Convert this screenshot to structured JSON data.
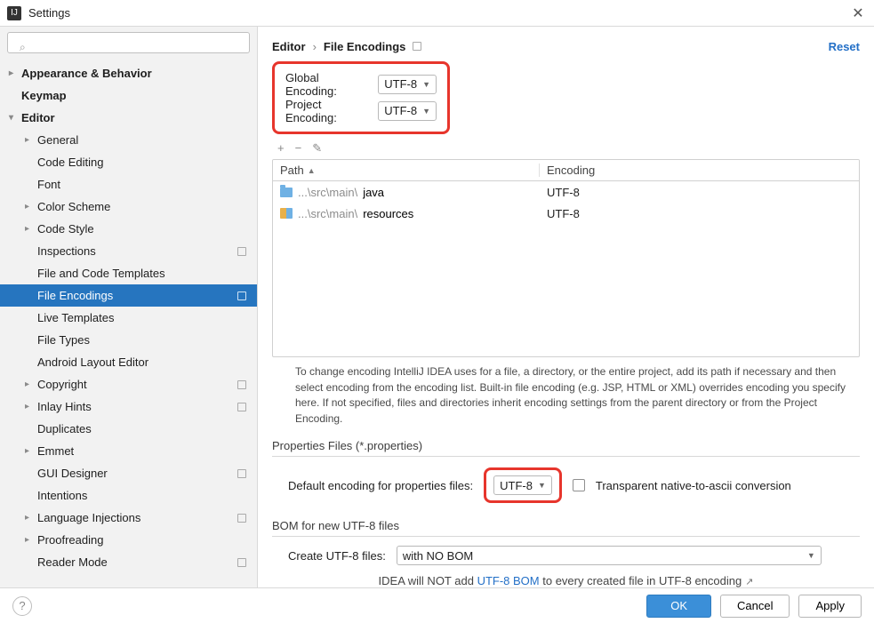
{
  "window": {
    "title": "Settings"
  },
  "search": {
    "placeholder": ""
  },
  "reset_label": "Reset",
  "breadcrumb": {
    "a": "Editor",
    "b": "File Encodings"
  },
  "sidebar": {
    "items": [
      {
        "label": "Appearance & Behavior",
        "depth": 0,
        "arrow": "right",
        "bold": true
      },
      {
        "label": "Keymap",
        "depth": 0,
        "arrow": "",
        "bold": true
      },
      {
        "label": "Editor",
        "depth": 0,
        "arrow": "down",
        "bold": true
      },
      {
        "label": "General",
        "depth": 1,
        "arrow": "right"
      },
      {
        "label": "Code Editing",
        "depth": 1,
        "arrow": ""
      },
      {
        "label": "Font",
        "depth": 1,
        "arrow": ""
      },
      {
        "label": "Color Scheme",
        "depth": 1,
        "arrow": "right"
      },
      {
        "label": "Code Style",
        "depth": 1,
        "arrow": "right"
      },
      {
        "label": "Inspections",
        "depth": 1,
        "arrow": "",
        "badge": true
      },
      {
        "label": "File and Code Templates",
        "depth": 1,
        "arrow": ""
      },
      {
        "label": "File Encodings",
        "depth": 1,
        "arrow": "",
        "badge": true,
        "selected": true
      },
      {
        "label": "Live Templates",
        "depth": 1,
        "arrow": ""
      },
      {
        "label": "File Types",
        "depth": 1,
        "arrow": ""
      },
      {
        "label": "Android Layout Editor",
        "depth": 1,
        "arrow": ""
      },
      {
        "label": "Copyright",
        "depth": 1,
        "arrow": "right",
        "badge": true
      },
      {
        "label": "Inlay Hints",
        "depth": 1,
        "arrow": "right",
        "badge": true
      },
      {
        "label": "Duplicates",
        "depth": 1,
        "arrow": ""
      },
      {
        "label": "Emmet",
        "depth": 1,
        "arrow": "right"
      },
      {
        "label": "GUI Designer",
        "depth": 1,
        "arrow": "",
        "badge": true
      },
      {
        "label": "Intentions",
        "depth": 1,
        "arrow": ""
      },
      {
        "label": "Language Injections",
        "depth": 1,
        "arrow": "right",
        "badge": true
      },
      {
        "label": "Proofreading",
        "depth": 1,
        "arrow": "right"
      },
      {
        "label": "Reader Mode",
        "depth": 1,
        "arrow": "",
        "badge": true
      }
    ]
  },
  "encodings": {
    "global_label": "Global Encoding:",
    "global_value": "UTF-8",
    "project_label": "Project Encoding:",
    "project_value": "UTF-8"
  },
  "table": {
    "headers": {
      "path": "Path",
      "encoding": "Encoding"
    },
    "rows": [
      {
        "prefix": "...\\src\\main\\",
        "name": "java",
        "encoding": "UTF-8",
        "icon": "folder"
      },
      {
        "prefix": "...\\src\\main\\",
        "name": "resources",
        "encoding": "UTF-8",
        "icon": "resources"
      }
    ]
  },
  "toolbar": {
    "add": "+",
    "remove": "−",
    "edit": "✎"
  },
  "help_text": "To change encoding IntelliJ IDEA uses for a file, a directory, or the entire project, add its path if necessary and then select encoding from the encoding list. Built-in file encoding (e.g. JSP, HTML or XML) overrides encoding you specify here. If not specified, files and directories inherit encoding settings from the parent directory or from the Project Encoding.",
  "properties": {
    "section": "Properties Files (*.properties)",
    "label": "Default encoding for properties files:",
    "value": "UTF-8",
    "checkbox_label": "Transparent native-to-ascii conversion"
  },
  "bom": {
    "section": "BOM for new UTF-8 files",
    "label": "Create UTF-8 files:",
    "value": "with NO BOM",
    "note_pre": "IDEA will NOT add ",
    "note_link": "UTF-8 BOM",
    "note_post": " to every created file in UTF-8 encoding"
  },
  "buttons": {
    "ok": "OK",
    "cancel": "Cancel",
    "apply": "Apply"
  }
}
